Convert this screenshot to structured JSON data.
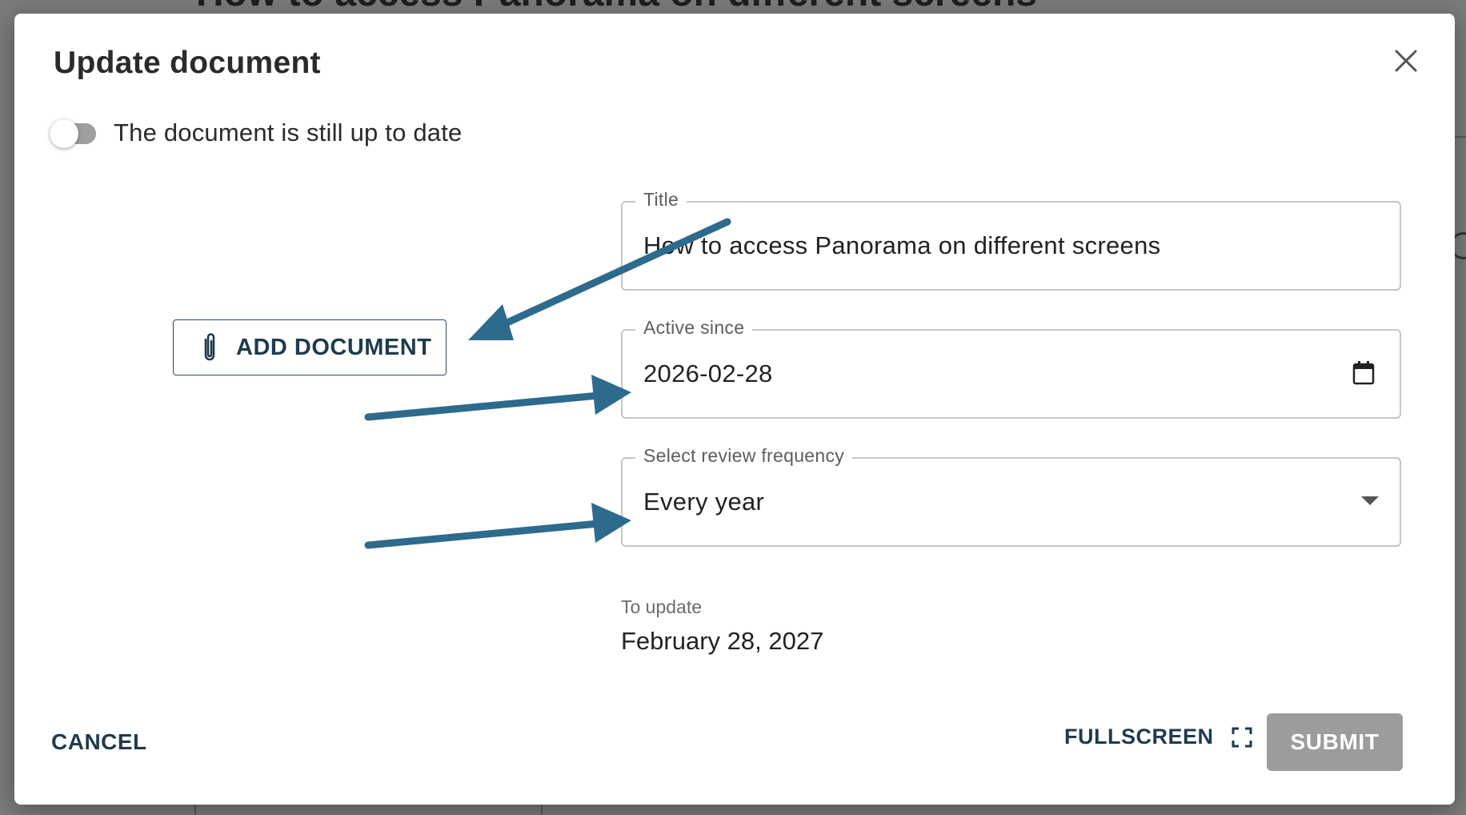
{
  "background": {
    "heading": "How to access Panorama on different screens"
  },
  "dialog": {
    "title": "Update document",
    "close_icon": "close-icon"
  },
  "toggle": {
    "label": "The document is still up to date",
    "checked": false
  },
  "add_document": {
    "label": "ADD DOCUMENT",
    "icon": "paperclip-icon"
  },
  "form": {
    "title": {
      "label": "Title",
      "value": "How to access Panorama on different screens"
    },
    "active_since": {
      "label": "Active since",
      "value": "2026-02-28",
      "icon": "calendar-icon"
    },
    "review_frequency": {
      "label": "Select review frequency",
      "value": "Every year",
      "icon": "dropdown-arrow-icon"
    }
  },
  "to_update": {
    "label": "To update",
    "value": "February 28, 2027"
  },
  "footer": {
    "cancel": "CANCEL",
    "fullscreen": "FULLSCREEN",
    "fullscreen_icon": "fullscreen-icon",
    "submit": "SUBMIT"
  },
  "colors": {
    "annotation_arrow": "#2e6a8c",
    "primary_text": "#1f3b4d",
    "submit_disabled": "#9c9c9c",
    "toggle_track": "#9e9e9e"
  }
}
